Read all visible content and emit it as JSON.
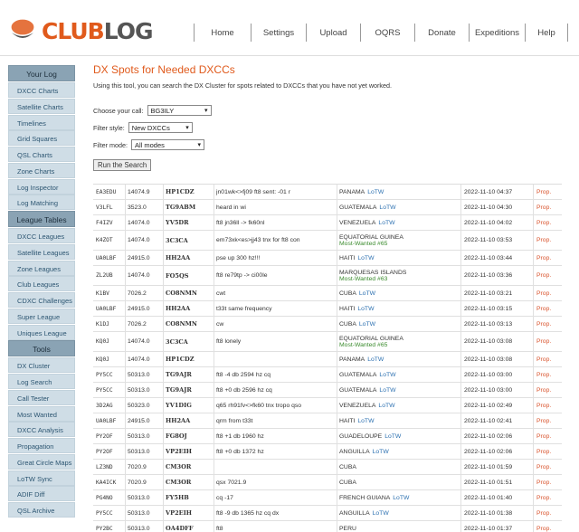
{
  "header": {
    "logo_club": "CLUB",
    "logo_log": "LOG",
    "nav": [
      "Home",
      "Settings",
      "Upload",
      "OQRS",
      "Donate",
      "Expeditions",
      "Help"
    ]
  },
  "sidebar": {
    "sections": [
      {
        "title": "Your Log",
        "items": [
          "DXCC Charts",
          "Satellite Charts",
          "Timelines",
          "Grid Squares",
          "QSL Charts",
          "Zone Charts",
          "Log Inspector",
          "Log Matching"
        ]
      },
      {
        "title": "League Tables",
        "items": [
          "DXCC Leagues",
          "Satellite Leagues",
          "Zone Leagues",
          "Club Leagues",
          "CDXC Challenges",
          "Super League",
          "Uniques League"
        ]
      },
      {
        "title": "Tools",
        "items": [
          "DX Cluster",
          "Log Search",
          "Call Tester",
          "Most Wanted",
          "DXCC Analysis",
          "Propagation",
          "Great Circle Maps",
          "LoTW Sync",
          "ADIF Diff",
          "QSL Archive"
        ]
      }
    ]
  },
  "main": {
    "title": "DX Spots for Needed DXCCs",
    "description": "Using this tool, you can search the DX Cluster for spots related to DXCCs that you have not yet worked.",
    "form": {
      "call_label": "Choose your call:",
      "call_value": "BG3ILY",
      "style_label": "Filter style:",
      "style_value": "New DXCCs",
      "mode_label": "Filter mode:",
      "mode_value": "All modes",
      "run_button": "Run the Search"
    }
  },
  "table": {
    "lotw_label": "LoTW",
    "prop_label": "Prop.",
    "rows": [
      {
        "spotter": "EA3EDU",
        "freq": "14074.9",
        "call": "HP1CDZ",
        "comment": "jn01wk<>fj09 ft8 sent: -01 r",
        "country": "PANAMA",
        "lotw": true,
        "mw": "",
        "time": "2022-11-10 04:37"
      },
      {
        "spotter": "V3LFL",
        "freq": "3523.0",
        "call": "TG9ABM",
        "comment": "heard in wi",
        "country": "GUATEMALA",
        "lotw": true,
        "mw": "",
        "time": "2022-11-10 04:30"
      },
      {
        "spotter": "F4IZV",
        "freq": "14074.0",
        "call": "YV5DR",
        "comment": "ft8 jn36ll -> fk60nl",
        "country": "VENEZUELA",
        "lotw": true,
        "mw": "",
        "time": "2022-11-10 04:02"
      },
      {
        "spotter": "K4ZOT",
        "freq": "14074.0",
        "call": "3C3CA",
        "comment": "em73xk<es>jj43 tnx for ft8 con",
        "country": "EQUATORIAL GUINEA",
        "lotw": false,
        "mw": "Most-Wanted #65",
        "time": "2022-11-10 03:53"
      },
      {
        "spotter": "UA0LBF",
        "freq": "24915.0",
        "call": "HH2AA",
        "comment": "pse up 300 hz!!!",
        "country": "HAITI",
        "lotw": true,
        "mw": "",
        "time": "2022-11-10 03:44"
      },
      {
        "spotter": "ZL2UB",
        "freq": "14074.0",
        "call": "FO5QS",
        "comment": "ft8 re79tp -> ci00le",
        "country": "MARQUESAS ISLANDS",
        "lotw": false,
        "mw": "Most-Wanted #63",
        "time": "2022-11-10 03:36"
      },
      {
        "spotter": "K1BV",
        "freq": "7026.2",
        "call": "CO8NMN",
        "comment": "cwt",
        "country": "CUBA",
        "lotw": true,
        "mw": "",
        "time": "2022-11-10 03:21"
      },
      {
        "spotter": "UA0LBF",
        "freq": "24915.0",
        "call": "HH2AA",
        "comment": "t33t same frequency",
        "country": "HAITI",
        "lotw": true,
        "mw": "",
        "time": "2022-11-10 03:15"
      },
      {
        "spotter": "K1DJ",
        "freq": "7026.2",
        "call": "CO8NMN",
        "comment": "cw",
        "country": "CUBA",
        "lotw": true,
        "mw": "",
        "time": "2022-11-10 03:13"
      },
      {
        "spotter": "KQ0J",
        "freq": "14074.0",
        "call": "3C3CA",
        "comment": "ft8 lonely",
        "country": "EQUATORIAL GUINEA",
        "lotw": false,
        "mw": "Most-Wanted #65",
        "time": "2022-11-10 03:08"
      },
      {
        "spotter": "KQ0J",
        "freq": "14074.0",
        "call": "HP1CDZ",
        "comment": "",
        "country": "PANAMA",
        "lotw": true,
        "mw": "",
        "time": "2022-11-10 03:08"
      },
      {
        "spotter": "PY5CC",
        "freq": "50313.0",
        "call": "TG9AJR",
        "comment": "ft8 -4 db 2594 hz cq",
        "country": "GUATEMALA",
        "lotw": true,
        "mw": "",
        "time": "2022-11-10 03:00"
      },
      {
        "spotter": "PY5CC",
        "freq": "50313.0",
        "call": "TG9AJR",
        "comment": "ft8 +0 db 2596 hz cq",
        "country": "GUATEMALA",
        "lotw": true,
        "mw": "",
        "time": "2022-11-10 03:00"
      },
      {
        "spotter": "3D2AG",
        "freq": "50323.0",
        "call": "YV1DIG",
        "comment": "q65 rh91fv<>fk60 tnx tropo qso",
        "country": "VENEZUELA",
        "lotw": true,
        "mw": "",
        "time": "2022-11-10 02:49"
      },
      {
        "spotter": "UA0LBF",
        "freq": "24915.0",
        "call": "HH2AA",
        "comment": "qrm from t33t",
        "country": "HAITI",
        "lotw": true,
        "mw": "",
        "time": "2022-11-10 02:41"
      },
      {
        "spotter": "PY2OF",
        "freq": "50313.0",
        "call": "FG8OJ",
        "comment": "ft8 +1 db 1960 hz",
        "country": "GUADELOUPE",
        "lotw": true,
        "mw": "",
        "time": "2022-11-10 02:06"
      },
      {
        "spotter": "PY2OF",
        "freq": "50313.0",
        "call": "VP2EIH",
        "comment": "ft8 +0 db 1372 hz",
        "country": "ANGUILLA",
        "lotw": true,
        "mw": "",
        "time": "2022-11-10 02:06"
      },
      {
        "spotter": "LZ3ND",
        "freq": "7020.9",
        "call": "CM3OR",
        "comment": "",
        "country": "CUBA",
        "lotw": false,
        "mw": "",
        "time": "2022-11-10 01:59"
      },
      {
        "spotter": "KA4ICK",
        "freq": "7020.9",
        "call": "CM3OR",
        "comment": "qsx 7021.9",
        "country": "CUBA",
        "lotw": false,
        "mw": "",
        "time": "2022-11-10 01:51"
      },
      {
        "spotter": "PG4NO",
        "freq": "50313.0",
        "call": "FY5HB",
        "comment": "cq -17",
        "country": "FRENCH GUIANA",
        "lotw": true,
        "mw": "",
        "time": "2022-11-10 01:40"
      },
      {
        "spotter": "PY5CC",
        "freq": "50313.0",
        "call": "VP2EIH",
        "comment": "ft8 -9 db 1365 hz cq dx",
        "country": "ANGUILLA",
        "lotw": true,
        "mw": "",
        "time": "2022-11-10 01:38"
      },
      {
        "spotter": "PY2BC",
        "freq": "50313.0",
        "call": "OA4DFF",
        "comment": "ft8",
        "country": "PERU",
        "lotw": false,
        "mw": "",
        "time": "2022-11-10 01:37"
      }
    ]
  }
}
